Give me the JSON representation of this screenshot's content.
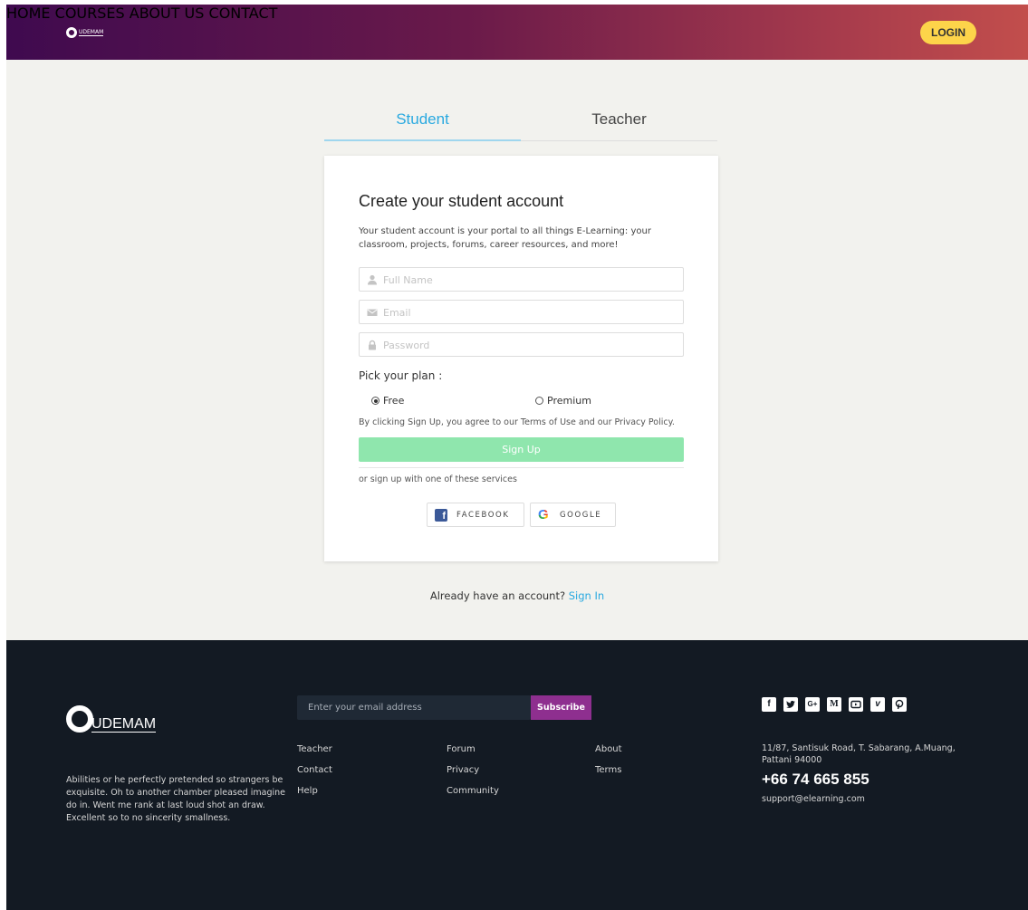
{
  "header": {
    "logo_text": "UDEMAM",
    "nav": [
      "HOME",
      "COURSES",
      "ABOUT US",
      "CONTACT"
    ],
    "login": "LOGIN"
  },
  "tabs": {
    "student": "Student",
    "teacher": "Teacher"
  },
  "form": {
    "title": "Create your student account",
    "description": "Your student account is your portal to all things E-Learning: your classroom, projects, forums, career resources, and more!",
    "fullname_placeholder": "Full Name",
    "email_placeholder": "Email",
    "password_placeholder": "Password",
    "pick_plan": "Pick your plan :",
    "plan_free": "Free",
    "plan_premium": "Premium",
    "terms": "By clicking Sign Up, you agree to our Terms of Use and our Privacy Policy.",
    "signup": "Sign Up",
    "services": "or sign up with one of these services",
    "facebook": "FACEBOOK",
    "google": "GOOGLE"
  },
  "signin": {
    "prompt": "Already have an account?",
    "link": "Sign In"
  },
  "footer": {
    "logo_text": "UDEMAM",
    "about": "Abilities or he perfectly pretended so strangers be exquisite. Oh to another chamber pleased imagine do in. Went me rank at last loud shot an draw. Excellent so to no sincerity smallness.",
    "email_placeholder": "Enter your email address",
    "subscribe": "Subscribe",
    "links": {
      "col1": [
        "Teacher",
        "Contact",
        "Help"
      ],
      "col2": [
        "Forum",
        "Privacy",
        "Community"
      ],
      "col3": [
        "About",
        "Terms"
      ]
    },
    "social_icons": [
      "facebook-icon",
      "twitter-icon",
      "google-plus-icon",
      "medium-icon",
      "youtube-icon",
      "vimeo-icon",
      "pinterest-icon"
    ],
    "address": "11/87, Santisuk Road, T. Sabarang, A.Muang, Pattani 94000",
    "phone": "+66 74 665 855",
    "email": "support@elearning.com"
  }
}
